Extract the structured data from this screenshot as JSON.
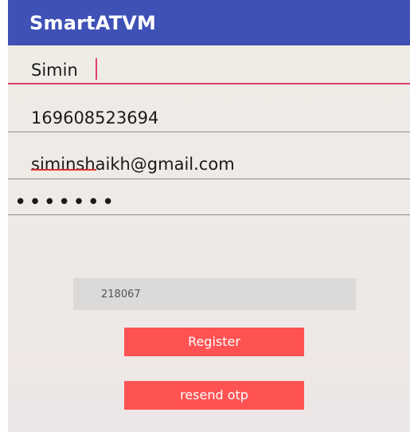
{
  "app_bar": {
    "title": "SmartATVM"
  },
  "form": {
    "name_value": "Simin",
    "aadhaar_value": "169608523694",
    "email_value": "siminshaikh@gmail.com",
    "password_value": "•••••••",
    "otp_value": "218067"
  },
  "buttons": {
    "register_label": "Register",
    "resend_otp_label": "resend otp"
  },
  "colors": {
    "app_bar": "#3f51b5",
    "button": "#ff5252",
    "focus_underline": "#e0406e"
  }
}
